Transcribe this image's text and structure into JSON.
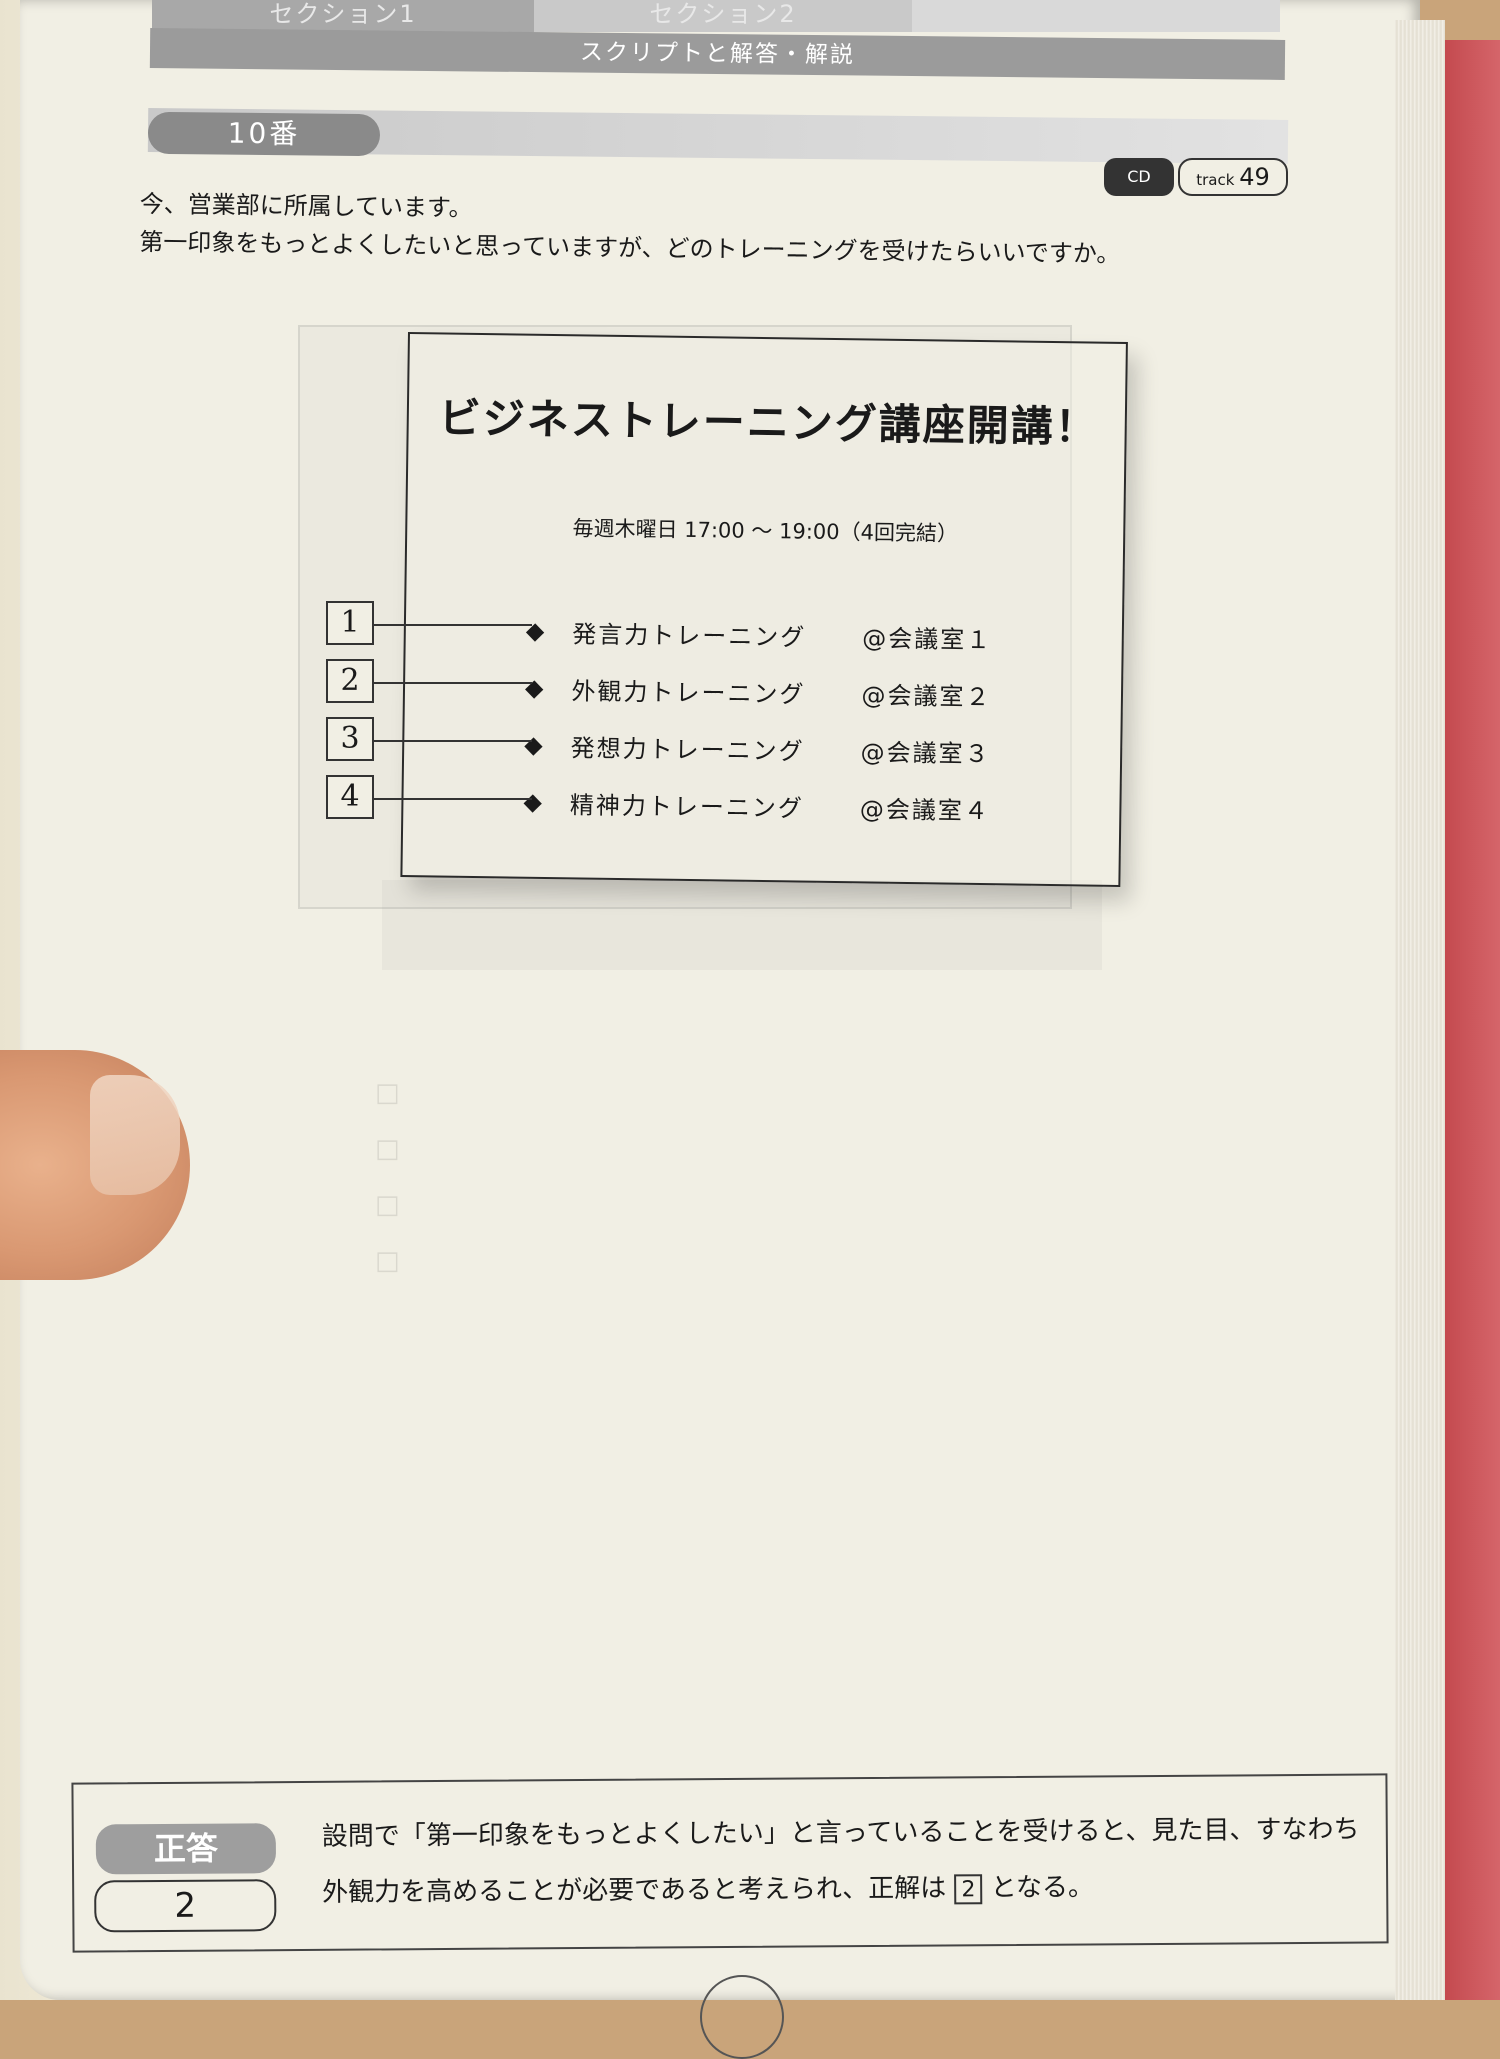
{
  "header": {
    "tabs": [
      "セクション1",
      "セクション2",
      ""
    ],
    "bar_title": "スクリプトと解答・解説"
  },
  "question": {
    "number": "10番",
    "cd_label": "CD",
    "track_label": "track",
    "track_number": "49",
    "line1": "今、営業部に所属しています。",
    "line2": "第一印象をもっとよくしたいと思っていますが、どのトレーニングを受けたらいいですか。"
  },
  "slide": {
    "title": "ビジネストレーニング講座開講！",
    "schedule": "毎週木曜日 17:00 ～ 19:00（4回完結）",
    "items": [
      {
        "num": "1",
        "course": "発言力トレーニング",
        "room": "@会議室１"
      },
      {
        "num": "2",
        "course": "外観力トレーニング",
        "room": "@会議室２"
      },
      {
        "num": "3",
        "course": "発想力トレーニング",
        "room": "@会議室３"
      },
      {
        "num": "4",
        "course": "精神力トレーニング",
        "room": "@会議室４"
      }
    ],
    "bullet": "◆"
  },
  "answer": {
    "label": "正答",
    "value": "2",
    "text_before": "設問で「第一印象をもっとよくしたい」と言っていることを受けると、見た目、すなわち外観力を高めることが必要であると考えられ、正解は",
    "text_box": "2",
    "text_after": "となる。"
  }
}
